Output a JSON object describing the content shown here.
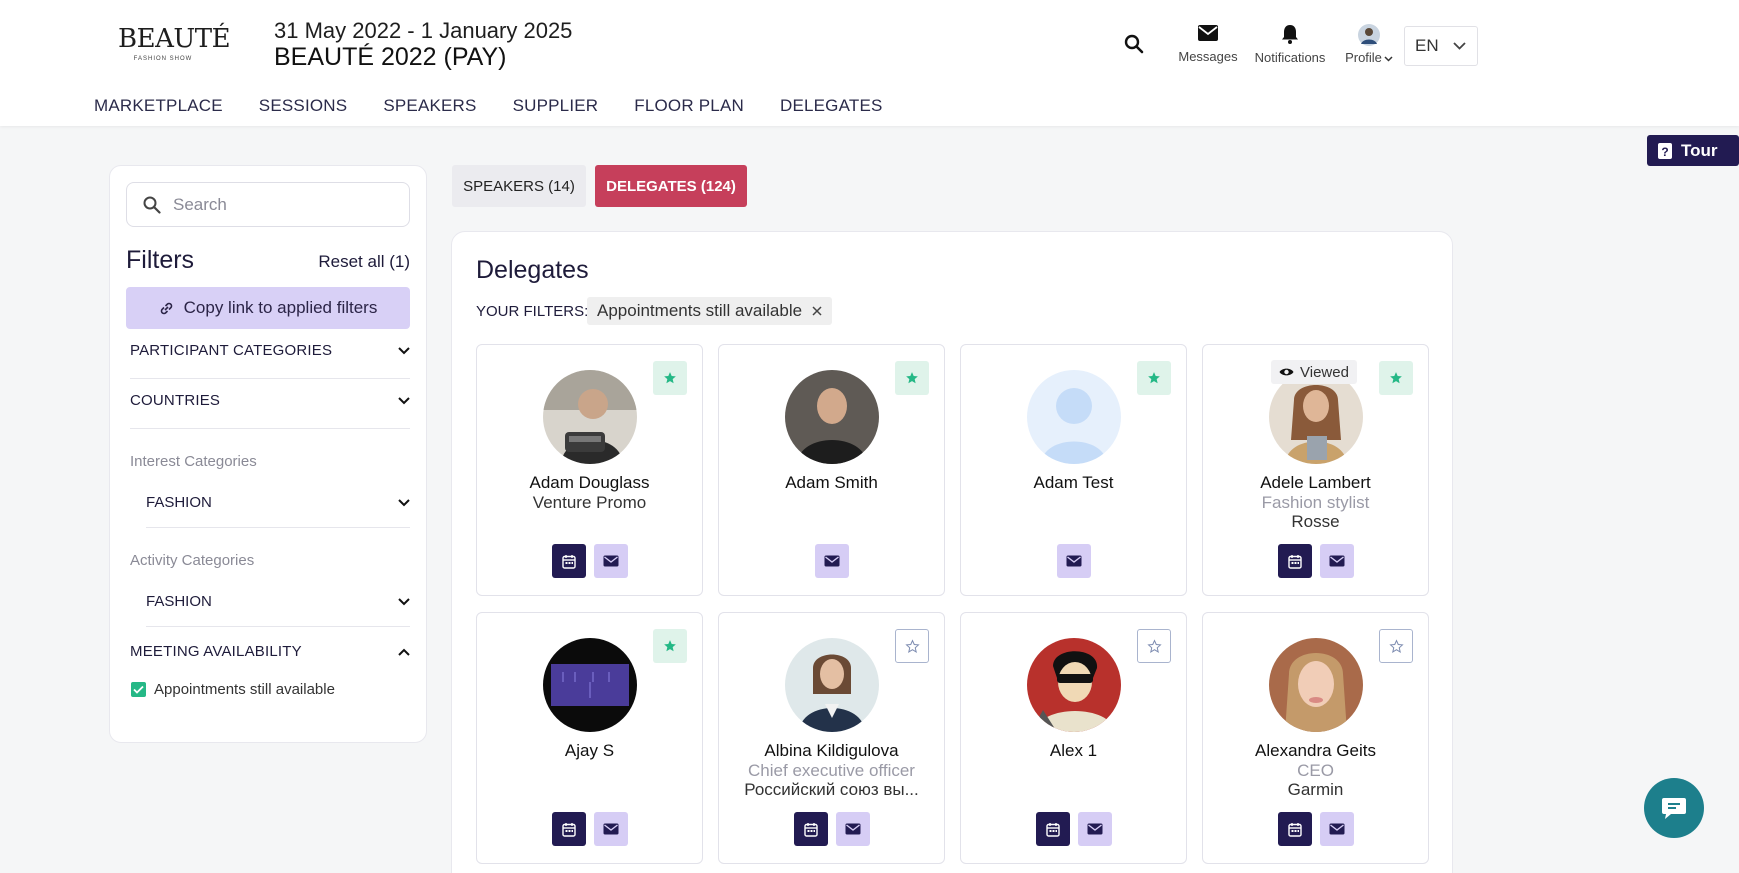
{
  "header": {
    "logo_text": "BEAUTÉ",
    "logo_sub": "FASHION SHOW",
    "event_dates": "31 May 2022 - 1 January 2025",
    "event_title": "BEAUTÉ 2022 (PAY)",
    "messages_label": "Messages",
    "notifications_label": "Notifications",
    "profile_label": "Profile",
    "language": "EN"
  },
  "nav": [
    "MARKETPLACE",
    "SESSIONS",
    "SPEAKERS",
    "SUPPLIER",
    "FLOOR PLAN",
    "DELEGATES"
  ],
  "tour_label": "Tour",
  "sidebar": {
    "search_placeholder": "Search",
    "filters_title": "Filters",
    "reset_label": "Reset all (1)",
    "copy_link_label": "Copy link to applied filters",
    "participant_categories": "PARTICIPANT CATEGORIES",
    "countries": "COUNTRIES",
    "interest_categories_label": "Interest Categories",
    "interest_fashion": "FASHION",
    "activity_categories_label": "Activity Categories",
    "activity_fashion": "FASHION",
    "meeting_availability": "MEETING AVAILABILITY",
    "appointments_label": "Appointments still available"
  },
  "tabs": {
    "speakers": "SPEAKERS (14)",
    "delegates": "DELEGATES (124)"
  },
  "main": {
    "title": "Delegates",
    "your_filters_label": "YOUR FILTERS:",
    "filter_chip": "Appointments still available",
    "viewed_label": "Viewed"
  },
  "delegates": [
    {
      "name": "Adam Douglass",
      "role": "",
      "company": "Venture Promo",
      "favorite": true,
      "calendar": true
    },
    {
      "name": "Adam Smith",
      "role": "",
      "company": "",
      "favorite": true,
      "calendar": false
    },
    {
      "name": "Adam Test",
      "role": "",
      "company": "",
      "favorite": true,
      "calendar": false
    },
    {
      "name": "Adele Lambert",
      "role": "Fashion stylist",
      "company": "Rosse",
      "favorite": true,
      "calendar": true,
      "viewed": true
    },
    {
      "name": "Ajay S",
      "role": "",
      "company": "",
      "favorite": true,
      "calendar": true
    },
    {
      "name": "Albina Kildigulova",
      "role": "Chief executive officer",
      "company": "Российский союз вы...",
      "favorite": false,
      "calendar": true
    },
    {
      "name": "Alex 1",
      "role": "",
      "company": "",
      "favorite": false,
      "calendar": true
    },
    {
      "name": "Alexandra Geits",
      "role": "CEO",
      "company": "Garmin",
      "favorite": false,
      "calendar": true
    }
  ],
  "colors": {
    "primary_dark": "#221b52",
    "accent_red": "#c63f5b",
    "light_purple": "#d6cdf5",
    "star_green": "#25b886",
    "chat_teal": "#1d7f8c"
  }
}
